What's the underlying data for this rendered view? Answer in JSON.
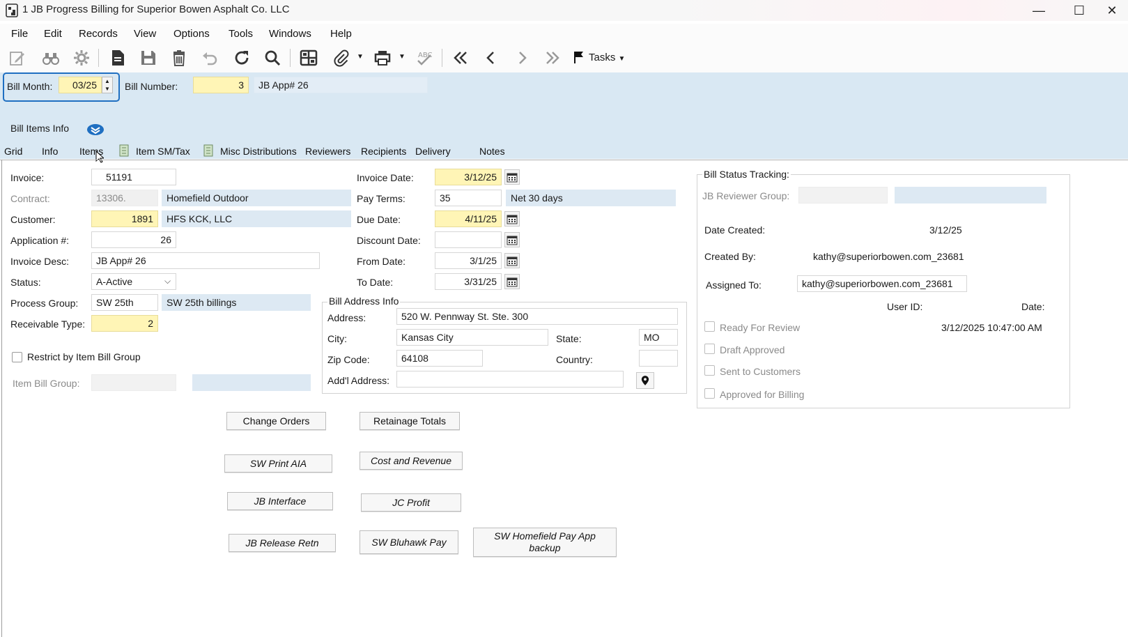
{
  "window": {
    "title": "1 JB Progress Billing for Superior Bowen  Asphalt Co. LLC",
    "minimize": "—",
    "maximize": "☐",
    "close": "✕"
  },
  "menu": [
    "File",
    "Edit",
    "Records",
    "View",
    "Options",
    "Tools",
    "Windows",
    "Help"
  ],
  "toolbar": {
    "tasks_label": "Tasks"
  },
  "header": {
    "bill_month_label": "Bill Month:",
    "bill_month_value": "03/25",
    "bill_number_label": "Bill Number:",
    "bill_number_value": "3",
    "bill_desc": "JB App# 26",
    "section_label": "Bill Items Info"
  },
  "tabs": [
    "Grid",
    "Info",
    "Items",
    "Item SM/Tax",
    "Misc Distributions",
    "Reviewers",
    "Recipients",
    "Delivery",
    "Notes"
  ],
  "form": {
    "invoice_label": "Invoice:",
    "invoice_value": "51191",
    "contract_label": "Contract:",
    "contract_value": "13306.",
    "contract_desc": "Homefield Outdoor",
    "customer_label": "Customer:",
    "customer_value": "1891",
    "customer_desc": "HFS KCK, LLC",
    "application_label": "Application #:",
    "application_value": "26",
    "invoice_desc_label": "Invoice Desc:",
    "invoice_desc_value": "JB App# 26",
    "status_label": "Status:",
    "status_value": "A-Active",
    "process_group_label": "Process Group:",
    "process_group_value": "SW 25th",
    "process_group_desc": "SW 25th billings",
    "receivable_type_label": "Receivable Type:",
    "receivable_type_value": "2",
    "restrict_label": "Restrict by Item Bill Group",
    "item_bill_group_label": "Item Bill Group:",
    "invoice_date_label": "Invoice Date:",
    "invoice_date_value": "3/12/25",
    "pay_terms_label": "Pay Terms:",
    "pay_terms_value": "35",
    "pay_terms_desc": "Net 30 days",
    "due_date_label": "Due Date:",
    "due_date_value": "4/11/25",
    "discount_date_label": "Discount Date:",
    "discount_date_value": "",
    "from_date_label": "From Date:",
    "from_date_value": "3/1/25",
    "to_date_label": "To Date:",
    "to_date_value": "3/31/25"
  },
  "address": {
    "group_label": "Bill Address Info",
    "address_label": "Address:",
    "address_value": "520 W. Pennway St. Ste. 300",
    "city_label": "City:",
    "city_value": "Kansas City",
    "state_label": "State:",
    "state_value": "MO",
    "zip_label": "Zip Code:",
    "zip_value": "64108",
    "country_label": "Country:",
    "country_value": "",
    "addl_label": "Add'l Address:",
    "addl_value": ""
  },
  "status_tracking": {
    "group_label": "Bill Status Tracking:",
    "reviewer_group_label": "JB Reviewer Group:",
    "date_created_label": "Date Created:",
    "date_created_value": "3/12/25",
    "created_by_label": "Created By:",
    "created_by_value": "kathy@superiorbowen.com_23681",
    "assigned_to_label": "Assigned To:",
    "assigned_to_value": "kathy@superiorbowen.com_23681",
    "user_id_header": "User ID:",
    "date_header": "Date:",
    "ready_label": "Ready For Review",
    "ready_date": "3/12/2025 10:47:00 AM",
    "draft_label": "Draft Approved",
    "sent_label": "Sent to Customers",
    "approved_label": "Approved for Billing"
  },
  "buttons": {
    "change_orders": "Change Orders",
    "retainage_totals": "Retainage Totals",
    "sw_print_aia": "SW Print AIA",
    "cost_revenue": "Cost and Revenue",
    "jb_interface": "JB Interface",
    "jc_profit": "JC Profit",
    "jb_release_retn": "JB Release Retn",
    "sw_bluhawk_pay": "SW Bluhawk Pay",
    "sw_homefield_line1": "SW Homefield Pay App",
    "sw_homefield_line2": "backup"
  },
  "colors": {
    "accent_blue": "#1f6fc1",
    "header_band": "#d9e8f3",
    "required_yellow": "#fff5b6"
  }
}
